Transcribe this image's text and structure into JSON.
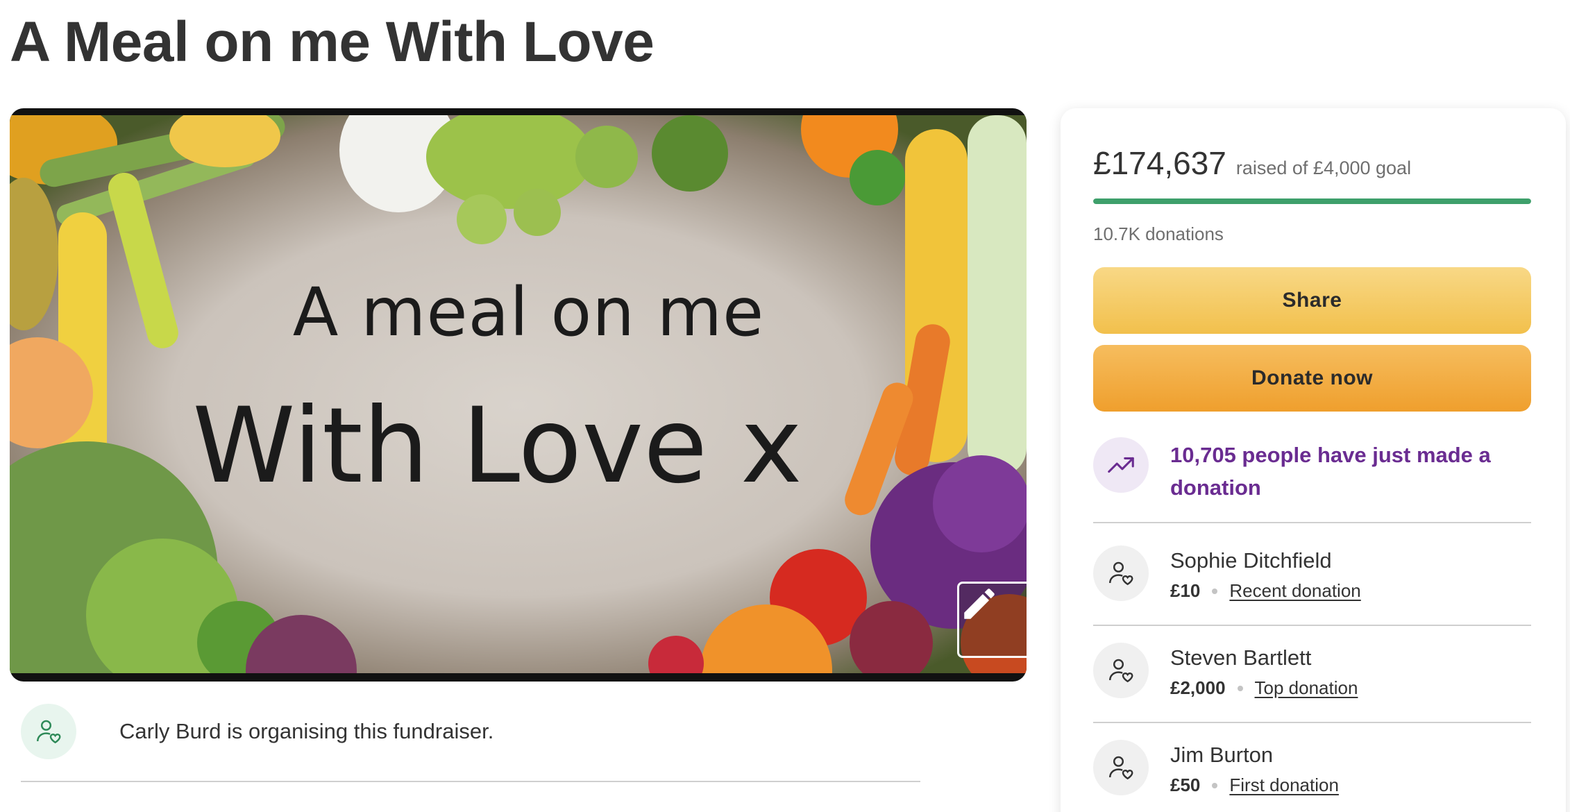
{
  "page": {
    "title": "A Meal on me With Love"
  },
  "hero": {
    "line1": "A meal on me",
    "line2": "With Love x",
    "edit_icon": "pencil-icon"
  },
  "organiser": {
    "text": "Carly Burd is organising this fundraiser.",
    "icon": "user-heart-icon"
  },
  "stats": {
    "raised": "£174,637",
    "goal": "raised of £4,000 goal",
    "donations": "10.7K donations",
    "progress_fraction": 1.0
  },
  "actions": {
    "share": "Share",
    "donate": "Donate now"
  },
  "activity": {
    "text": "10,705 people have just made a donation",
    "icon": "trending-up-icon"
  },
  "donors": [
    {
      "name": "Sophie Ditchfield",
      "amount": "£10",
      "type": "Recent donation"
    },
    {
      "name": "Steven Bartlett",
      "amount": "£2,000",
      "type": "Top donation"
    },
    {
      "name": "Jim Burton",
      "amount": "£50",
      "type": "First donation"
    }
  ],
  "colors": {
    "accent_green": "#3ea06b",
    "share_button": "#f2c04c",
    "donate_button": "#ef9f2d",
    "activity_purple": "#6a2c91"
  }
}
